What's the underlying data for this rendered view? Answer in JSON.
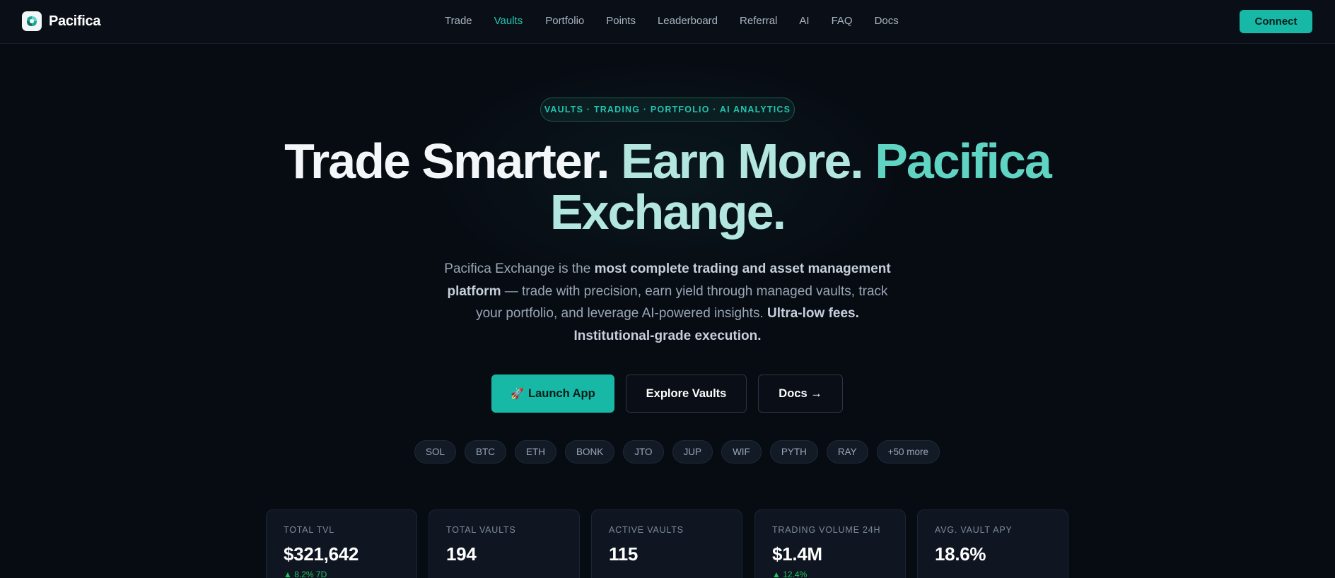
{
  "brand": {
    "name": "Pacifica",
    "logo_icon": "pacifica-logo-icon"
  },
  "nav": {
    "links": [
      {
        "label": "Trade",
        "active": false
      },
      {
        "label": "Vaults",
        "active": true
      },
      {
        "label": "Portfolio",
        "active": false
      },
      {
        "label": "Points",
        "active": false
      },
      {
        "label": "Leaderboard",
        "active": false
      },
      {
        "label": "Referral",
        "active": false
      },
      {
        "label": "AI",
        "active": false
      },
      {
        "label": "FAQ",
        "active": false
      },
      {
        "label": "Docs",
        "active": false
      }
    ],
    "connect_label": "Connect"
  },
  "hero": {
    "tagline": "VAULTS · TRADING · PORTFOLIO · AI ANALYTICS",
    "headline_part1": "Trade Smarter.",
    "headline_part2": "Earn More.",
    "headline_part3": "Pacifica",
    "headline_part4": "Exchange.",
    "sub_1": "Pacifica Exchange is the ",
    "sub_2": "most complete trading and asset management platform",
    "sub_3": " — trade with precision, earn yield through managed vaults, track your portfolio, and leverage AI-powered insights. ",
    "sub_4": "Ultra-low fees. Institutional-grade execution.",
    "launch_label": "Launch App",
    "launch_icon": "rocket-icon",
    "explore_label": "Explore Vaults",
    "docs_label": "Docs →"
  },
  "tokens": [
    "SOL",
    "BTC",
    "ETH",
    "BONK",
    "JTO",
    "JUP",
    "WIF",
    "PYTH",
    "RAY",
    "+50 more"
  ],
  "stats": [
    {
      "label": "TOTAL TVL",
      "value": "$321,642",
      "change": "▲ 8.2% 7D"
    },
    {
      "label": "TOTAL VAULTS",
      "value": "194",
      "change": ""
    },
    {
      "label": "ACTIVE VAULTS",
      "value": "115",
      "change": ""
    },
    {
      "label": "TRADING VOLUME 24H",
      "value": "$1.4M",
      "change": "▲ 12.4%"
    },
    {
      "label": "AVG. VAULT APY",
      "value": "18.6%",
      "change": ""
    }
  ],
  "colors": {
    "accent": "#18b8a6",
    "background": "#070b12",
    "positive": "#22c55e"
  }
}
